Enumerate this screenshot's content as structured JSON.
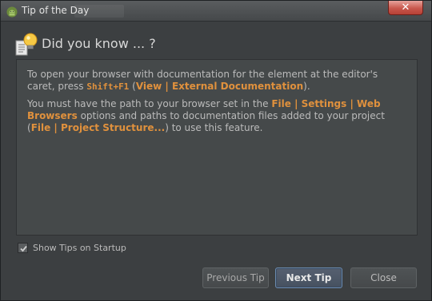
{
  "window": {
    "title": "Tip of the Day",
    "close_label": "✕"
  },
  "header": {
    "title": "Did you know ... ?"
  },
  "tip": {
    "p1_a": "To open your browser with documentation for the element at the editor's caret, press ",
    "p1_shortcut": "Shift+F1",
    "p1_b": " (",
    "p1_menu": "View | External Documentation",
    "p1_c": ").",
    "p2_a": "You must have the path to your browser set in the ",
    "p2_menu1": "File | Settings | Web Browsers",
    "p2_b": " options and paths to documentation files added to your project (",
    "p2_menu2": "File | Project Structure...",
    "p2_c": ") to use this feature."
  },
  "startup": {
    "label": "Show Tips on Startup",
    "checked": true
  },
  "buttons": {
    "previous": "Previous Tip",
    "next": "Next Tip",
    "close": "Close"
  },
  "icons": {
    "app": "android-icon",
    "header": "lightbulb-icon",
    "close": "close-icon",
    "check": "check-icon"
  },
  "colors": {
    "background": "#3c3f41",
    "panel": "#45494a",
    "text": "#bbbbbb",
    "highlight": "#e0913d",
    "close_button": "#c9584d",
    "default_button_border": "#6b8bb0"
  }
}
